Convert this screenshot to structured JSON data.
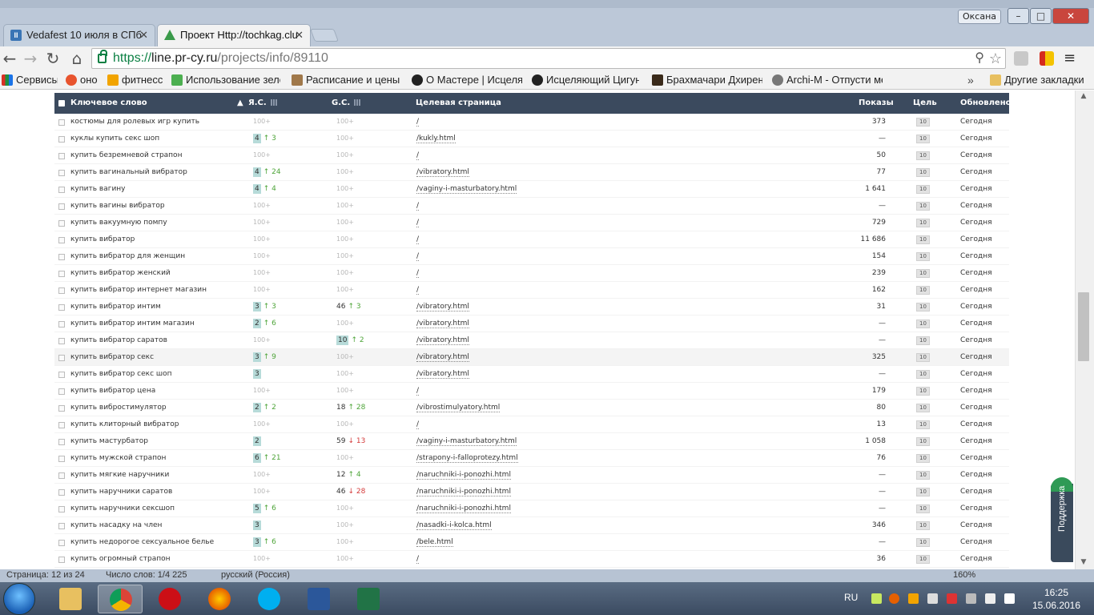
{
  "window": {
    "user": "Оксана",
    "min_label": "–",
    "max_label": "□",
    "close_label": "✕"
  },
  "tabs": [
    {
      "title": "Vedafest 10 июля в СПб",
      "close": "✕"
    },
    {
      "title": "Проект Http://tochkag.clu",
      "close": "✕"
    }
  ],
  "toolbar": {
    "url_scheme": "https://",
    "url_host": "line.pr-cy.ru",
    "url_path": "/projects/info/89110"
  },
  "bookmarks": {
    "items": [
      "Сервисы",
      "оно",
      "фитнесс",
      "Использование зеле",
      "Расписание и цены в",
      "О Мастере | Исцеляю",
      "Исцеляющий Цигун",
      "Брахмачари Дхирен",
      "Archi-M - Отпусти ме"
    ],
    "more": "»",
    "other": "Другие закладки"
  },
  "table": {
    "headers": {
      "keyword": "Ключевое слово",
      "ya": "Я.С.",
      "gc": "G.C.",
      "target": "Целевая страница",
      "views": "Показы",
      "goal": "Цель",
      "updated": "Обновлено"
    },
    "sort_indicator": "▲",
    "rows": [
      {
        "kw": "костюмы для ролевых игр купить",
        "ya": "100+",
        "ya_d": "",
        "ya_dir": "",
        "gc": "100+",
        "gc_d": "",
        "gc_dir": "",
        "url": "/",
        "views": "373",
        "goal": "10",
        "upd": "Сегодня"
      },
      {
        "kw": "куклы купить секс шоп",
        "ya": "4",
        "ya_d": "↑ 3",
        "ya_dir": "up",
        "gc": "100+",
        "gc_d": "",
        "gc_dir": "",
        "url": "/kukly.html",
        "views": "—",
        "goal": "10",
        "upd": "Сегодня"
      },
      {
        "kw": "купить безремневой страпон",
        "ya": "100+",
        "ya_d": "",
        "ya_dir": "",
        "gc": "100+",
        "gc_d": "",
        "gc_dir": "",
        "url": "/",
        "views": "50",
        "goal": "10",
        "upd": "Сегодня"
      },
      {
        "kw": "купить вагинальный вибратор",
        "ya": "4",
        "ya_d": "↑ 24",
        "ya_dir": "up",
        "gc": "100+",
        "gc_d": "",
        "gc_dir": "",
        "url": "/vibratory.html",
        "views": "77",
        "goal": "10",
        "upd": "Сегодня"
      },
      {
        "kw": "купить вагину",
        "ya": "4",
        "ya_d": "↑ 4",
        "ya_dir": "up",
        "gc": "100+",
        "gc_d": "",
        "gc_dir": "",
        "url": "/vaginy-i-masturbatory.html",
        "views": "1 641",
        "goal": "10",
        "upd": "Сегодня"
      },
      {
        "kw": "купить вагины вибратор",
        "ya": "100+",
        "ya_d": "",
        "ya_dir": "",
        "gc": "100+",
        "gc_d": "",
        "gc_dir": "",
        "url": "/",
        "views": "—",
        "goal": "10",
        "upd": "Сегодня"
      },
      {
        "kw": "купить вакуумную помпу",
        "ya": "100+",
        "ya_d": "",
        "ya_dir": "",
        "gc": "100+",
        "gc_d": "",
        "gc_dir": "",
        "url": "/",
        "views": "729",
        "goal": "10",
        "upd": "Сегодня"
      },
      {
        "kw": "купить вибратор",
        "ya": "100+",
        "ya_d": "",
        "ya_dir": "",
        "gc": "100+",
        "gc_d": "",
        "gc_dir": "",
        "url": "/",
        "views": "11 686",
        "goal": "10",
        "upd": "Сегодня"
      },
      {
        "kw": "купить вибратор для женщин",
        "ya": "100+",
        "ya_d": "",
        "ya_dir": "",
        "gc": "100+",
        "gc_d": "",
        "gc_dir": "",
        "url": "/",
        "views": "154",
        "goal": "10",
        "upd": "Сегодня"
      },
      {
        "kw": "купить вибратор женский",
        "ya": "100+",
        "ya_d": "",
        "ya_dir": "",
        "gc": "100+",
        "gc_d": "",
        "gc_dir": "",
        "url": "/",
        "views": "239",
        "goal": "10",
        "upd": "Сегодня"
      },
      {
        "kw": "купить вибратор интернет магазин",
        "ya": "100+",
        "ya_d": "",
        "ya_dir": "",
        "gc": "100+",
        "gc_d": "",
        "gc_dir": "",
        "url": "/",
        "views": "162",
        "goal": "10",
        "upd": "Сегодня"
      },
      {
        "kw": "купить вибратор интим",
        "ya": "3",
        "ya_d": "↑ 3",
        "ya_dir": "up",
        "gc": "46",
        "gc_d": "↑ 3",
        "gc_dir": "up",
        "url": "/vibratory.html",
        "views": "31",
        "goal": "10",
        "upd": "Сегодня"
      },
      {
        "kw": "купить вибратор интим магазин",
        "ya": "2",
        "ya_d": "↑ 6",
        "ya_dir": "up",
        "gc": "100+",
        "gc_d": "",
        "gc_dir": "",
        "url": "/vibratory.html",
        "views": "—",
        "goal": "10",
        "upd": "Сегодня"
      },
      {
        "kw": "купить вибратор саратов",
        "ya": "100+",
        "ya_d": "",
        "ya_dir": "",
        "gc": "10",
        "gc_d": "↑ 2",
        "gc_dir": "up",
        "url": "/vibratory.html",
        "views": "—",
        "goal": "10",
        "upd": "Сегодня"
      },
      {
        "kw": "купить вибратор секс",
        "ya": "3",
        "ya_d": "↑ 9",
        "ya_dir": "up",
        "gc": "100+",
        "gc_d": "",
        "gc_dir": "",
        "url": "/vibratory.html",
        "views": "325",
        "goal": "10",
        "upd": "Сегодня"
      },
      {
        "kw": "купить вибратор секс шоп",
        "ya": "3",
        "ya_d": "",
        "ya_dir": "",
        "gc": "100+",
        "gc_d": "",
        "gc_dir": "",
        "url": "/vibratory.html",
        "views": "—",
        "goal": "10",
        "upd": "Сегодня"
      },
      {
        "kw": "купить вибратор цена",
        "ya": "100+",
        "ya_d": "",
        "ya_dir": "",
        "gc": "100+",
        "gc_d": "",
        "gc_dir": "",
        "url": "/",
        "views": "179",
        "goal": "10",
        "upd": "Сегодня"
      },
      {
        "kw": "купить вибростимулятор",
        "ya": "2",
        "ya_d": "↑ 2",
        "ya_dir": "up",
        "gc": "18",
        "gc_d": "↑ 28",
        "gc_dir": "up",
        "url": "/vibrostimulyatory.html",
        "views": "80",
        "goal": "10",
        "upd": "Сегодня"
      },
      {
        "kw": "купить клиторный вибратор",
        "ya": "100+",
        "ya_d": "",
        "ya_dir": "",
        "gc": "100+",
        "gc_d": "",
        "gc_dir": "",
        "url": "/",
        "views": "13",
        "goal": "10",
        "upd": "Сегодня"
      },
      {
        "kw": "купить мастурбатор",
        "ya": "2",
        "ya_d": "",
        "ya_dir": "",
        "gc": "59",
        "gc_d": "↓ 13",
        "gc_dir": "down",
        "url": "/vaginy-i-masturbatory.html",
        "views": "1 058",
        "goal": "10",
        "upd": "Сегодня"
      },
      {
        "kw": "купить мужской страпон",
        "ya": "6",
        "ya_d": "↑ 21",
        "ya_dir": "up",
        "gc": "100+",
        "gc_d": "",
        "gc_dir": "",
        "url": "/strapony-i-falloprotezy.html",
        "views": "76",
        "goal": "10",
        "upd": "Сегодня"
      },
      {
        "kw": "купить мягкие наручники",
        "ya": "100+",
        "ya_d": "",
        "ya_dir": "",
        "gc": "12",
        "gc_d": "↑ 4",
        "gc_dir": "up",
        "url": "/naruchniki-i-ponozhi.html",
        "views": "—",
        "goal": "10",
        "upd": "Сегодня"
      },
      {
        "kw": "купить наручники саратов",
        "ya": "100+",
        "ya_d": "",
        "ya_dir": "",
        "gc": "46",
        "gc_d": "↓ 28",
        "gc_dir": "down",
        "url": "/naruchniki-i-ponozhi.html",
        "views": "—",
        "goal": "10",
        "upd": "Сегодня"
      },
      {
        "kw": "купить наручники сексшоп",
        "ya": "5",
        "ya_d": "↑ 6",
        "ya_dir": "up",
        "gc": "100+",
        "gc_d": "",
        "gc_dir": "",
        "url": "/naruchniki-i-ponozhi.html",
        "views": "—",
        "goal": "10",
        "upd": "Сегодня"
      },
      {
        "kw": "купить насадку на член",
        "ya": "3",
        "ya_d": "",
        "ya_dir": "",
        "gc": "100+",
        "gc_d": "",
        "gc_dir": "",
        "url": "/nasadki-i-kolca.html",
        "views": "346",
        "goal": "10",
        "upd": "Сегодня"
      },
      {
        "kw": "купить недорогое сексуальное белье",
        "ya": "3",
        "ya_d": "↑ 6",
        "ya_dir": "up",
        "gc": "100+",
        "gc_d": "",
        "gc_dir": "",
        "url": "/bele.html",
        "views": "—",
        "goal": "10",
        "upd": "Сегодня"
      },
      {
        "kw": "купить огромный страпон",
        "ya": "100+",
        "ya_d": "",
        "ya_dir": "",
        "gc": "100+",
        "gc_d": "",
        "gc_dir": "",
        "url": "/",
        "views": "36",
        "goal": "10",
        "upd": "Сегодня"
      }
    ]
  },
  "support": {
    "label": "Поддержка"
  },
  "statusbar": {
    "page": "Страница: 12 из 24",
    "words": "Число слов: 1/4 225",
    "lang": "русский (Россия)",
    "zoom": "160%"
  },
  "taskbar": {
    "lang": "RU",
    "time": "16:25",
    "date": "15.06.2016"
  }
}
